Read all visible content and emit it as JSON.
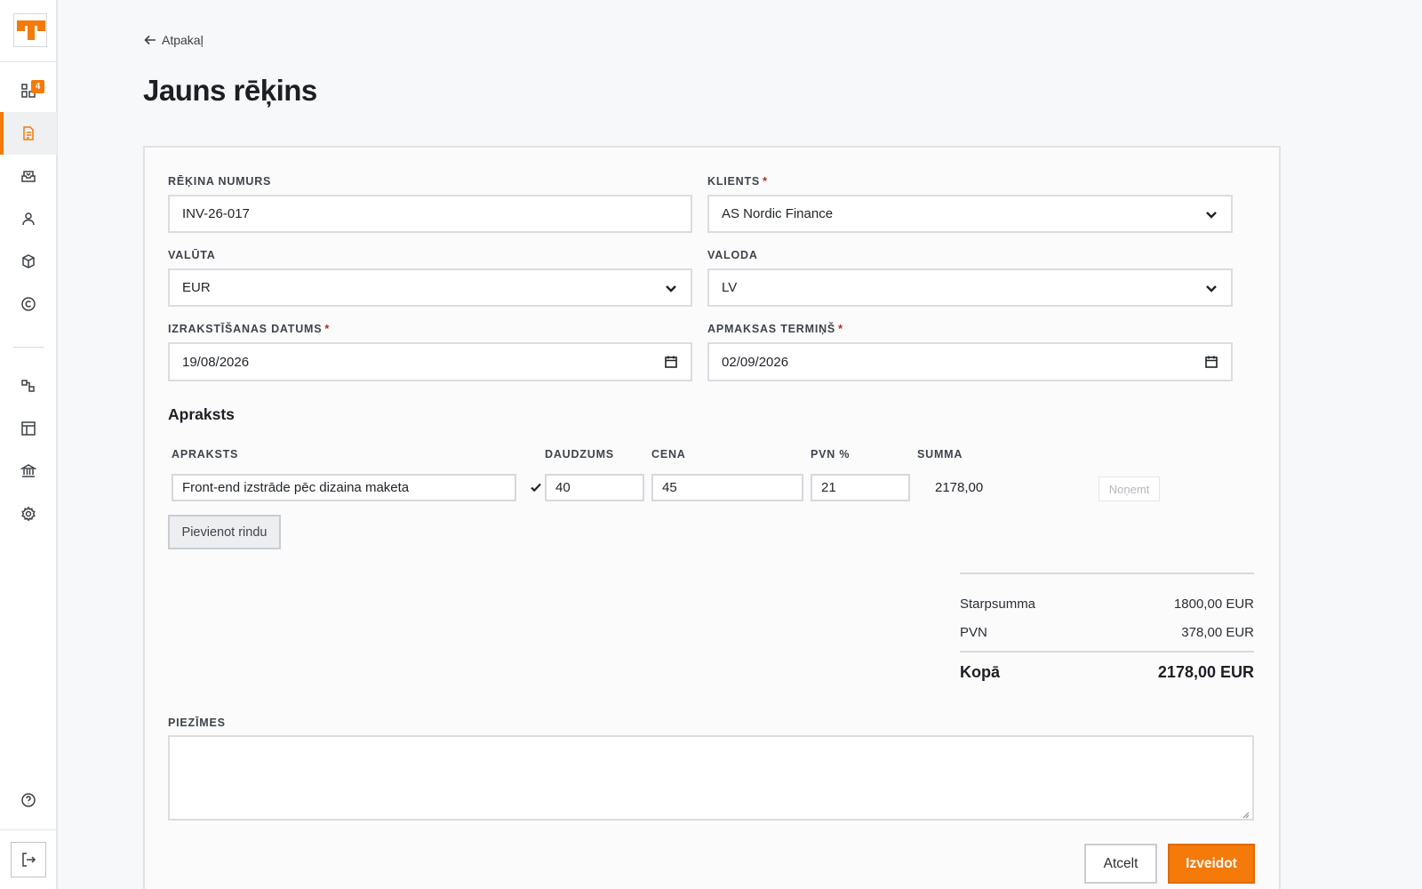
{
  "sidebar": {
    "logo": "brand-logo",
    "items": [
      {
        "icon": "dashboard-icon",
        "badge": "4"
      },
      {
        "icon": "invoice-document-icon",
        "active": true
      },
      {
        "icon": "inbox-icon"
      },
      {
        "icon": "user-icon"
      },
      {
        "icon": "package-box-icon"
      },
      {
        "icon": "copyright-icon"
      },
      {
        "icon": "integrations-icon"
      },
      {
        "icon": "layout-template-icon"
      },
      {
        "icon": "bank-icon"
      },
      {
        "icon": "settings-gear-icon"
      },
      {
        "icon": "help-circle-icon"
      },
      {
        "icon": "logout-icon"
      }
    ]
  },
  "header": {
    "back_label": "Atpakaļ",
    "title": "Jauns rēķins"
  },
  "form": {
    "invoice_number": {
      "label": "RĒĶINA NUMURS",
      "value": "INV-26-017"
    },
    "client": {
      "label": "KLIENTS",
      "required": "*",
      "value": "AS Nordic Finance"
    },
    "currency": {
      "label": "VALŪTA",
      "value": "EUR"
    },
    "language": {
      "label": "VALODA",
      "value": "LV"
    },
    "issue_date": {
      "label": "IZRAKSTĪŠANAS DATUMS",
      "required": "*",
      "value": "19/08/2026"
    },
    "due_date": {
      "label": "APMAKSAS TERMIŅŠ",
      "required": "*",
      "value": "02/09/2026"
    }
  },
  "lines": {
    "section_title": "Apraksts",
    "columns": {
      "description": "APRAKSTS",
      "quantity": "DAUDZUMS",
      "price": "CENA",
      "vat": "PVN %",
      "sum": "SUMMA"
    },
    "rows": [
      {
        "description": "Front-end izstrāde pēc dizaina maketa",
        "quantity": "40",
        "price": "45",
        "vat": "21",
        "sum": "2178,00",
        "remove_label": "Noņemt"
      }
    ],
    "add_row_label": "Pievienot rindu"
  },
  "totals": {
    "subtotal_label": "Starpsumma",
    "subtotal_value": "1800,00 EUR",
    "vat_label": "PVN",
    "vat_value": "378,00 EUR",
    "total_label": "Kopā",
    "total_value": "2178,00 EUR"
  },
  "notes": {
    "label": "PIEZĪMES",
    "value": ""
  },
  "actions": {
    "cancel_label": "Atcelt",
    "create_label": "Izveidot"
  },
  "colors": {
    "accent": "#f47a0a",
    "required": "#b3261e"
  }
}
